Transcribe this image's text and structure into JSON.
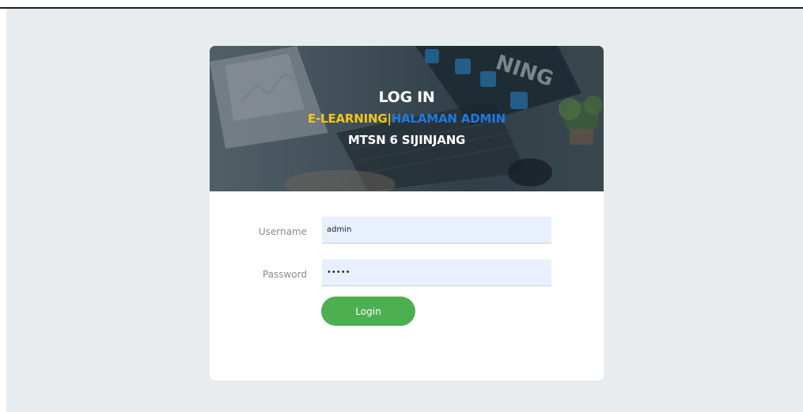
{
  "header": {
    "title": "LOG IN",
    "subtitle_left": "E-LEARNING",
    "subtitle_sep": "|",
    "subtitle_right": "HALAMAN ADMIN",
    "school": "MTSN 6 SIJINJANG",
    "background_text": "NING"
  },
  "form": {
    "username_label": "Username",
    "username_value": "admin",
    "password_label": "Password",
    "password_value": "•••••",
    "login_label": "Login"
  },
  "colors": {
    "accent_yellow": "#f5c518",
    "accent_blue": "#1f7ae0",
    "button_green": "#4caf50",
    "input_bg": "#e8f0fe"
  }
}
